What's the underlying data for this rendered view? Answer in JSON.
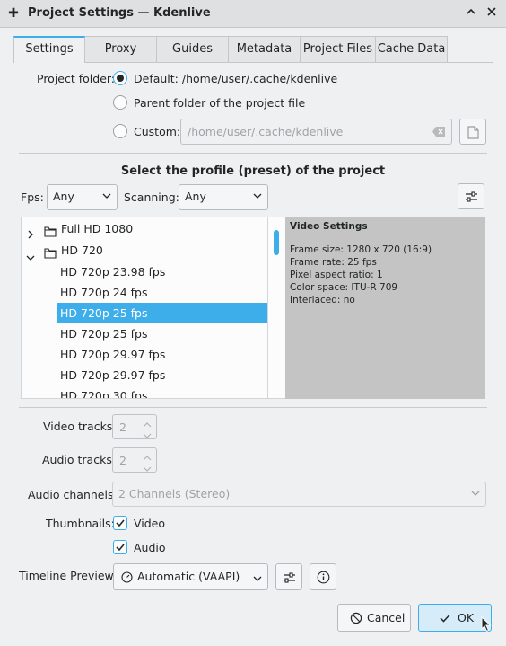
{
  "window": {
    "title": "Project Settings — Kdenlive"
  },
  "tabs": [
    {
      "label": "Settings",
      "active": true
    },
    {
      "label": "Proxy",
      "active": false
    },
    {
      "label": "Guides",
      "active": false
    },
    {
      "label": "Metadata",
      "active": false
    },
    {
      "label": "Project Files",
      "active": false
    },
    {
      "label": "Cache Data",
      "active": false
    }
  ],
  "project_folder": {
    "label": "Project folder:",
    "option_default": "Default: /home/user/.cache/kdenlive",
    "option_parent": "Parent folder of the project file",
    "option_custom": "Custom:",
    "custom_placeholder": "/home/user/.cache/kdenlive",
    "selected": "default"
  },
  "profile": {
    "heading": "Select the profile (preset) of the project",
    "fps_label": "Fps:",
    "fps_value": "Any",
    "scanning_label": "Scanning:",
    "scanning_value": "Any"
  },
  "tree": {
    "items": [
      {
        "label": "Full HD 1080",
        "type": "folder",
        "expanded": false
      },
      {
        "label": "HD 720",
        "type": "folder",
        "expanded": true
      },
      {
        "label": "HD 720p 23.98 fps",
        "type": "item"
      },
      {
        "label": "HD 720p 24 fps",
        "type": "item"
      },
      {
        "label": "HD 720p 25 fps",
        "type": "item",
        "selected": true
      },
      {
        "label": "HD 720p 25 fps",
        "type": "item"
      },
      {
        "label": "HD 720p 29.97 fps",
        "type": "item"
      },
      {
        "label": "HD 720p 29.97 fps",
        "type": "item"
      },
      {
        "label": "HD 720p 30 fps",
        "type": "item"
      }
    ]
  },
  "video_settings": {
    "heading": "Video Settings",
    "frame_size": "Frame size: 1280 x 720 (16:9)",
    "frame_rate": "Frame rate: 25 fps",
    "pixel_aspect": "Pixel aspect ratio: 1",
    "color_space": "Color space: ITU-R 709",
    "interlaced": "Interlaced: no"
  },
  "tracks": {
    "video_label": "Video tracks:",
    "video_value": "2",
    "audio_label": "Audio tracks:",
    "audio_value": "2"
  },
  "audio_channels": {
    "label": "Audio channels:",
    "value": "2 Channels (Stereo)"
  },
  "thumbnails": {
    "label": "Thumbnails:",
    "video_label": "Video",
    "video_checked": true,
    "audio_label": "Audio",
    "audio_checked": true
  },
  "timeline_preview": {
    "label": "Timeline Preview:",
    "value": "Automatic (VAAPI)"
  },
  "buttons": {
    "cancel": "Cancel",
    "ok": "OK"
  },
  "colors": {
    "accent": "#3daee9",
    "window_bg": "#eff0f1",
    "info_panel_bg": "#c4c4c4"
  }
}
